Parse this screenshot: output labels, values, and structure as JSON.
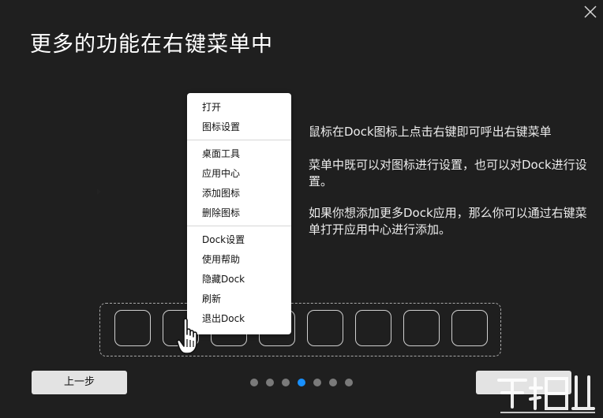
{
  "dialog": {
    "title": "更多的功能在右键菜单中",
    "close_icon": "close-icon"
  },
  "descriptions": [
    "鼠标在Dock图标上点击右键即可呼出右键菜单",
    "菜单中既可以对图标进行设置，也可以对Dock进行设置。",
    "如果你想添加更多Dock应用，那么你可以通过右键菜单打开应用中心进行添加。"
  ],
  "context_menu": {
    "groups": [
      [
        "打开",
        "图标设置"
      ],
      [
        "桌面工具",
        "应用中心",
        "添加图标",
        "删除图标"
      ],
      [
        "Dock设置",
        "使用帮助",
        "隐藏Dock",
        "刷新",
        "退出Dock"
      ]
    ],
    "submenu_icon": "chevron-right-icon"
  },
  "dock": {
    "slot_count": 8,
    "cursor_icon": "hand-pointer-icon"
  },
  "footer": {
    "prev_label": "上一步",
    "next_label": "",
    "page_count": 7,
    "current_page": 4
  },
  "colors": {
    "background": "#1f1f1f",
    "accent": "#1890ff",
    "button": "#e3e3e3"
  },
  "watermark_icon": "download-site-watermark-icon"
}
